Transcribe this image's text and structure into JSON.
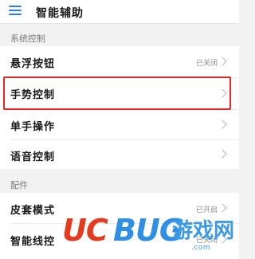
{
  "header": {
    "title": "智能辅助"
  },
  "sections": [
    {
      "label": "系统控制",
      "items": [
        {
          "label": "悬浮按钮",
          "status": "已关闭"
        },
        {
          "label": "手势控制",
          "status": ""
        },
        {
          "label": "单手操作",
          "status": ""
        },
        {
          "label": "语音控制",
          "status": ""
        }
      ]
    },
    {
      "label": "配件",
      "items": [
        {
          "label": "皮套模式",
          "status": "已开启"
        },
        {
          "label": "智能线控",
          "status": "已关闭"
        }
      ]
    }
  ],
  "watermark": {
    "part1": "UC",
    "part2": "BUG",
    "part3": "游戏网",
    "url": ".com"
  },
  "colors": {
    "accent": "#2a82e4",
    "highlight": "#e8262a",
    "wm_red": "#e53a1c",
    "wm_blue": "#2e8fe6"
  }
}
